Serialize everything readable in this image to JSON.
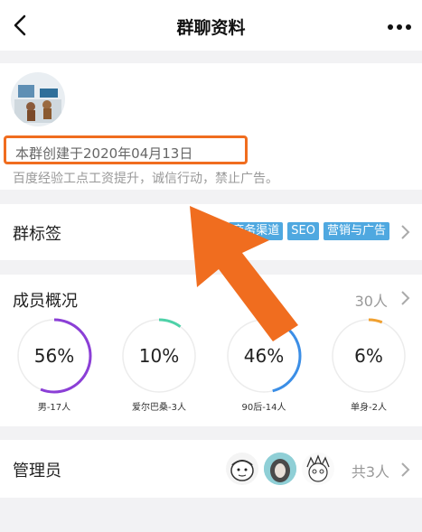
{
  "nav": {
    "title": "群聊资料"
  },
  "info": {
    "created": "本群创建于2020年04月13日",
    "description": "百度经验工点工资提升，诚信行动，禁止广告。"
  },
  "tags": {
    "label": "群标签",
    "items": [
      "商务渠道",
      "SEO",
      "营销与广告"
    ]
  },
  "members": {
    "label": "成员概况",
    "count": "30人",
    "stats": [
      {
        "pct": "56%",
        "value": 0.56,
        "label": "男-17人",
        "color": "#8b3fd6"
      },
      {
        "pct": "10%",
        "value": 0.1,
        "label": "爱尔巴桑-3人",
        "color": "#4ed1a8"
      },
      {
        "pct": "46%",
        "value": 0.46,
        "label": "90后-14人",
        "color": "#3b8ee6"
      },
      {
        "pct": "6%",
        "value": 0.06,
        "label": "单身-2人",
        "color": "#f0a030"
      }
    ]
  },
  "admins": {
    "label": "管理员",
    "count": "共3人"
  },
  "colors": {
    "highlight": "#f06d1f",
    "tag": "#4fa8e0"
  }
}
